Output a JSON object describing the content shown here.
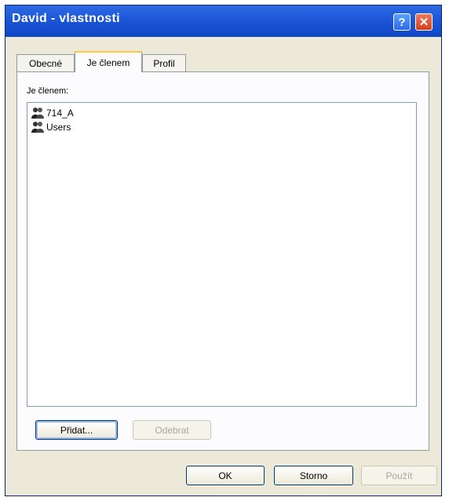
{
  "window": {
    "title": "David - vlastnosti"
  },
  "titlebar_buttons": {
    "help": "?",
    "close": "✕"
  },
  "tabs": [
    {
      "label": "Obecné"
    },
    {
      "label": "Je členem"
    },
    {
      "label": "Profil"
    }
  ],
  "members": {
    "label": "Je členem:",
    "items": [
      {
        "name": "714_A",
        "icon": "group-icon"
      },
      {
        "name": "Users",
        "icon": "group-icon"
      }
    ]
  },
  "buttons": {
    "add": "Přidat...",
    "remove": "Odebrat",
    "ok": "OK",
    "cancel": "Storno",
    "apply": "Použít"
  }
}
